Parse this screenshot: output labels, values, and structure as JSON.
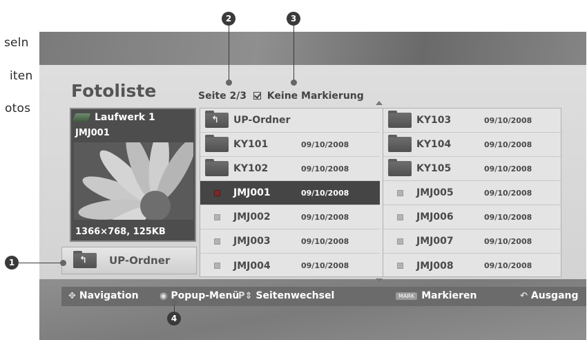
{
  "side_text": [
    "seln",
    "iten",
    "otos"
  ],
  "header": {
    "title": "Fotoliste",
    "page_info": "Seite 2/3",
    "marking_status": "Keine Markierung"
  },
  "preview": {
    "drive": "Laufwerk 1",
    "file": "JMJ001",
    "resolution": "1366×768, 125KB"
  },
  "up_button": {
    "label": "UP-Ordner"
  },
  "file_list": {
    "left_column": [
      {
        "type": "up-folder",
        "name": "UP-Ordner",
        "date": ""
      },
      {
        "type": "folder",
        "name": "KY101",
        "date": "09/10/2008"
      },
      {
        "type": "folder",
        "name": "KY102",
        "date": "09/10/2008"
      },
      {
        "type": "photo",
        "name": "JMJ001",
        "date": "09/10/2008",
        "selected": true
      },
      {
        "type": "photo",
        "name": "JMJ002",
        "date": "09/10/2008"
      },
      {
        "type": "photo",
        "name": "JMJ003",
        "date": "09/10/2008"
      },
      {
        "type": "photo",
        "name": "JMJ004",
        "date": "09/10/2008"
      }
    ],
    "right_column": [
      {
        "type": "folder",
        "name": "KY103",
        "date": "09/10/2008"
      },
      {
        "type": "folder",
        "name": "KY104",
        "date": "09/10/2008"
      },
      {
        "type": "folder",
        "name": "KY105",
        "date": "09/10/2008"
      },
      {
        "type": "photo",
        "name": "JMJ005",
        "date": "09/10/2008"
      },
      {
        "type": "photo",
        "name": "JMJ006",
        "date": "09/10/2008"
      },
      {
        "type": "photo",
        "name": "JMJ007",
        "date": "09/10/2008"
      },
      {
        "type": "photo",
        "name": "JMJ008",
        "date": "09/10/2008"
      }
    ]
  },
  "nav_bar": {
    "navigation": "Navigation",
    "popup_menu": "Popup-Menü",
    "page_change": "Seitenwechsel",
    "mark_key": "MARK",
    "mark": "Markieren",
    "exit": "Ausgang"
  },
  "callouts": [
    "1",
    "2",
    "3",
    "4"
  ]
}
